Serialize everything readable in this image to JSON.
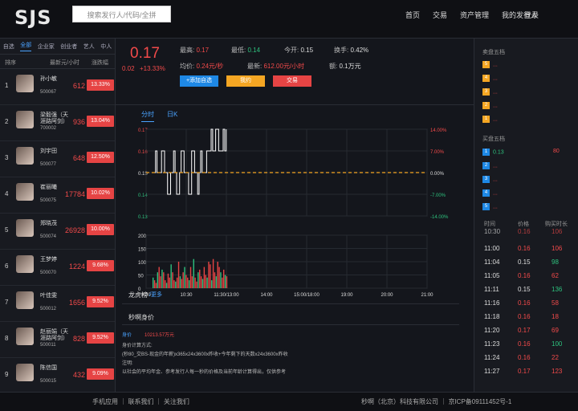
{
  "header": {
    "logo": "SJS",
    "search_placeholder": "搜索发行人/代码/全拼",
    "nav": [
      "首页",
      "交易",
      "资产管理",
      "我的发行人"
    ],
    "login": "登录"
  },
  "left": {
    "tabs": [
      "自选",
      "全部",
      "企业家",
      "创业者",
      "艺人",
      "中人"
    ],
    "active_tab": 1,
    "headers": {
      "rank": "排序",
      "rate": "最新元/小时",
      "change": "涨跌幅"
    },
    "rows": [
      {
        "rank": "1",
        "name": "孙小敏",
        "code": "500067",
        "price": "612",
        "pct": "13.33%"
      },
      {
        "rank": "2",
        "name": "梁毅强（天涯路阿剑）",
        "code": "700002",
        "price": "936",
        "pct": "13.04%"
      },
      {
        "rank": "3",
        "name": "刘宇田",
        "code": "500077",
        "price": "648",
        "pct": "12.50%"
      },
      {
        "rank": "4",
        "name": "崔丽曦",
        "code": "500075",
        "price": "17784",
        "pct": "10.02%"
      },
      {
        "rank": "5",
        "name": "郑晓茂",
        "code": "500074",
        "price": "26928",
        "pct": "10.00%"
      },
      {
        "rank": "6",
        "name": "王梦婷",
        "code": "500070",
        "price": "1224",
        "pct": "9.68%"
      },
      {
        "rank": "7",
        "name": "叶佳雯",
        "code": "500012",
        "price": "1656",
        "pct": "9.52%"
      },
      {
        "rank": "8",
        "name": "赵丽娟（天涯路阿剑）",
        "code": "500011",
        "price": "828",
        "pct": "9.52%"
      },
      {
        "rank": "9",
        "name": "陈信国",
        "code": "500015",
        "price": "432",
        "pct": "9.09%"
      }
    ]
  },
  "quote": {
    "price": "0.17",
    "change": "0.02",
    "change_pct": "+13.33%",
    "high_label": "最高:",
    "high": "0.17",
    "low_label": "最低:",
    "low": "0.14",
    "open_label": "今开:",
    "open": "0.15",
    "turnover_label": "换手:",
    "turnover": "0.42%",
    "avg_label": "均价:",
    "avg": "0.24元/秒",
    "latest_label": "最新:",
    "latest": "612.00元/小时",
    "amount_label": "额:",
    "amount": "0.1万元",
    "btn_add": "+添加自选",
    "btn_buy": "我约",
    "btn_trade": "交易",
    "color_blue": "#1e88e5",
    "color_orange": "#f5a623",
    "color_red": "#e64444"
  },
  "chart_tabs": [
    "分时",
    "日K"
  ],
  "chart_data": {
    "type": "line",
    "title": "",
    "price_axis": [
      0.17,
      0.16,
      0.15,
      0.14,
      0.13
    ],
    "pct_axis": [
      "14.00%",
      "7.00%",
      "0.00%",
      "-7.00%",
      "-14.00%"
    ],
    "volume_axis": [
      200,
      150,
      100,
      50,
      0
    ],
    "x_labels": [
      "9:30",
      "10:30",
      "11:30/13:00",
      "14:00",
      "15:00/18:00",
      "19:00",
      "20:00",
      "21:00"
    ],
    "ylim": [
      0.13,
      0.17
    ],
    "reference_price": 0.15,
    "price_series": [
      0.15,
      0.15,
      0.16,
      0.15,
      0.15,
      0.15,
      0.16,
      0.16,
      0.15,
      0.15,
      0.14,
      0.14,
      0.15,
      0.15,
      0.16,
      0.15,
      0.14,
      0.14,
      0.15,
      0.16,
      0.16,
      0.15,
      0.15,
      0.15,
      0.14,
      0.14,
      0.16,
      0.16,
      0.15,
      0.15,
      0.14,
      0.15,
      0.16,
      0.15,
      0.15,
      0.15,
      0.16,
      0.16,
      0.16,
      0.17,
      0.16,
      0.16,
      0.17,
      0.17,
      0.16,
      0.16,
      0.16,
      0.17,
      0.16,
      0.17
    ],
    "volumes": [
      40,
      30,
      20,
      60,
      80,
      45,
      70,
      60,
      30,
      20,
      55,
      40,
      90,
      60,
      30,
      25,
      40,
      100,
      45,
      35,
      60,
      80,
      50,
      40,
      30,
      80,
      45,
      110,
      40,
      25,
      60,
      70,
      45,
      35,
      80,
      50,
      40,
      100,
      90,
      30,
      110,
      60,
      45,
      100,
      80,
      60,
      40,
      70,
      50,
      45
    ]
  },
  "lower": {
    "dragon_title": "龙虎榜",
    "dragon_more": "/更多",
    "section_title": "秒啊身价",
    "worth_label": "身价",
    "worth_value": "10213.57万元",
    "formula_title": "身价计算方式:",
    "formula": "(秒80_交BS-现金的年薪)x365x24x3600x昨收+今年剩下的天数x24x3600x昨收",
    "note_title": "注明:",
    "note": "以社会的平均年金、参考发行人每一秒的价格及当前年龄计算得出，仅供参考"
  },
  "right": {
    "sell_title": "卖盘五档",
    "sell_levels": [
      {
        "n": "5",
        "price": "...",
        "color": "#f5a623"
      },
      {
        "n": "4",
        "price": "...",
        "color": "#f5a623"
      },
      {
        "n": "3",
        "price": "...",
        "color": "#f5a623"
      },
      {
        "n": "2",
        "price": "...",
        "color": "#f5a623"
      },
      {
        "n": "1",
        "price": "...",
        "color": "#f5a623"
      }
    ],
    "buy_title": "买盘五档",
    "buy_levels": [
      {
        "n": "1",
        "price": "0.13",
        "qty": "80",
        "color": "#1e88e5"
      },
      {
        "n": "2",
        "price": "...",
        "qty": "",
        "color": "#1e88e5"
      },
      {
        "n": "3",
        "price": "...",
        "qty": "",
        "color": "#1e88e5"
      },
      {
        "n": "4",
        "price": "...",
        "qty": "",
        "color": "#1e88e5"
      },
      {
        "n": "5",
        "price": "...",
        "qty": "",
        "color": "#1e88e5"
      }
    ],
    "tick_headers": [
      "时间",
      "价格",
      "购买时长"
    ],
    "ticks": [
      {
        "time": "10:30",
        "price": "0.16",
        "qty": "106",
        "pc": "r",
        "qc": "r"
      },
      {
        "time": "11:00",
        "price": "0.16",
        "qty": "106",
        "pc": "r",
        "qc": "r"
      },
      {
        "time": "11:04",
        "price": "0.15",
        "qty": "98",
        "pc": "w",
        "qc": "g"
      },
      {
        "time": "11:05",
        "price": "0.16",
        "qty": "62",
        "pc": "r",
        "qc": "r"
      },
      {
        "time": "11:11",
        "price": "0.15",
        "qty": "136",
        "pc": "w",
        "qc": "g"
      },
      {
        "time": "11:16",
        "price": "0.16",
        "qty": "58",
        "pc": "r",
        "qc": "r"
      },
      {
        "time": "11:18",
        "price": "0.16",
        "qty": "18",
        "pc": "r",
        "qc": "r"
      },
      {
        "time": "11:20",
        "price": "0.17",
        "qty": "69",
        "pc": "r",
        "qc": "r"
      },
      {
        "time": "11:23",
        "price": "0.16",
        "qty": "100",
        "pc": "r",
        "qc": "g"
      },
      {
        "time": "11:24",
        "price": "0.16",
        "qty": "22",
        "pc": "r",
        "qc": "r"
      },
      {
        "time": "11:27",
        "price": "0.17",
        "qty": "123",
        "pc": "r",
        "qc": "r"
      }
    ]
  },
  "footer": {
    "left": "手机应用 ｜ 联系我们 ｜ 关注我们",
    "right": "秒啊（北京）科技有限公司 ｜ 京ICP备09111452号-1"
  }
}
